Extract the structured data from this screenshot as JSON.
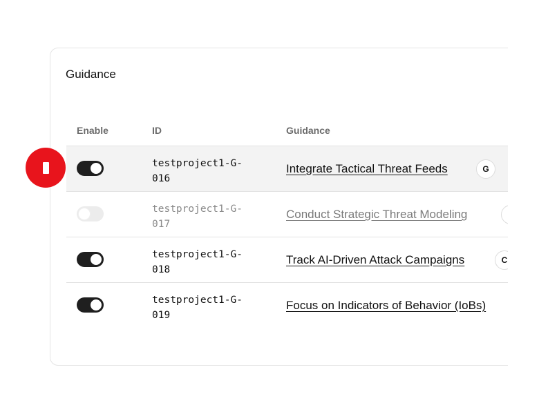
{
  "card": {
    "title": "Guidance"
  },
  "table": {
    "headers": {
      "enable": "Enable",
      "id": "ID",
      "guidance": "Guidance"
    },
    "rows": [
      {
        "enabled": true,
        "id": "testproject1-G-\n016",
        "guidance": "Integrate Tactical Threat Feeds",
        "tag": "G"
      },
      {
        "enabled": false,
        "id": "testproject1-G-\n017",
        "guidance": "Conduct Strategic Threat Modeling",
        "tag": ""
      },
      {
        "enabled": true,
        "id": "testproject1-G-\n018",
        "guidance": "Track AI-Driven Attack Campaigns",
        "tag": "C"
      },
      {
        "enabled": true,
        "id": "testproject1-G-\n019",
        "guidance": "Focus on Indicators of Behavior (IoBs)",
        "tag": ""
      }
    ]
  },
  "marker": {
    "icon": "step-marker-icon",
    "color": "#e8141c"
  }
}
